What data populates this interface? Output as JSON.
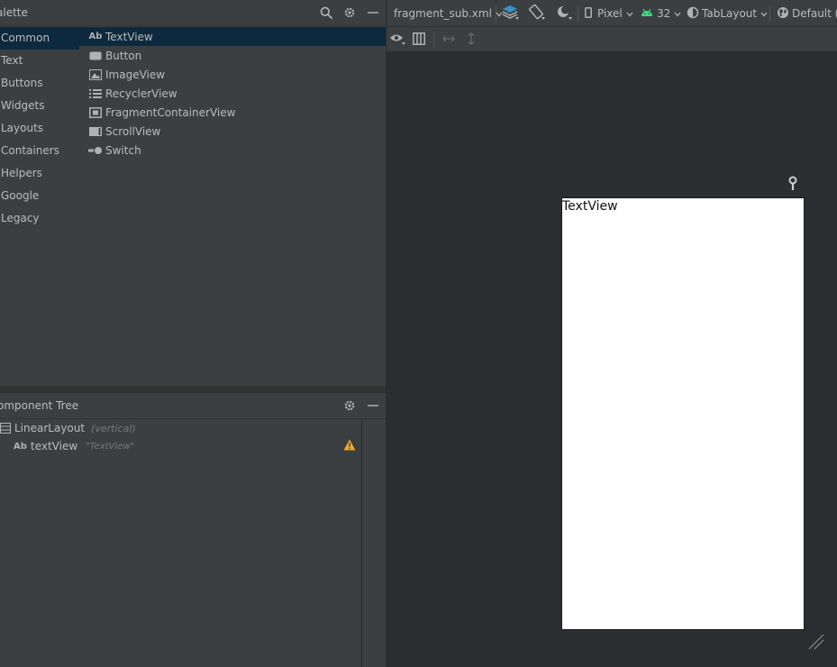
{
  "palette": {
    "title": "Palette",
    "title_visible": "alette",
    "categories": [
      "Common",
      "Text",
      "Buttons",
      "Widgets",
      "Layouts",
      "Containers",
      "Helpers",
      "Google",
      "Legacy"
    ],
    "selected_category": "Common",
    "widgets": [
      {
        "label": "TextView",
        "icon": "ab-icon"
      },
      {
        "label": "Button",
        "icon": "button-icon"
      },
      {
        "label": "ImageView",
        "icon": "image-icon"
      },
      {
        "label": "RecyclerView",
        "icon": "list-icon"
      },
      {
        "label": "FragmentContainerView",
        "icon": "fragment-icon"
      },
      {
        "label": "ScrollView",
        "icon": "scroll-icon"
      },
      {
        "label": "Switch",
        "icon": "switch-icon"
      }
    ],
    "ab_glyph": "Ab"
  },
  "component_tree": {
    "title_visible": "omponent Tree",
    "nodes": [
      {
        "name": "LinearLayout",
        "desc": "(vertical)",
        "icon": "linear-layout-icon"
      },
      {
        "name": "textView",
        "desc": "\"TextView\"",
        "icon": "ab-icon",
        "warning": true
      }
    ]
  },
  "toolbar": {
    "file": "fragment_sub.xml",
    "device": "Pixel",
    "api": "32",
    "theme": "TabLayout",
    "locale": "Default (e"
  },
  "design": {
    "device_text": "TextView"
  },
  "colors": {
    "selection": "#0d293e",
    "panel": "#3c3f41",
    "canvas": "#2b2d30",
    "android_green": "#3ddc84",
    "warning": "#f0a732",
    "layer_blue": "#3592c4"
  }
}
